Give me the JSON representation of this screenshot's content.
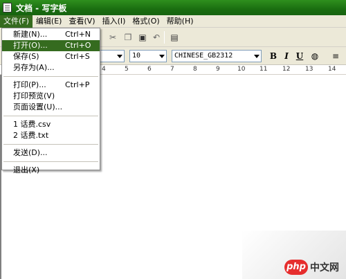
{
  "window": {
    "title": "文档 - 写字板"
  },
  "menubar": {
    "items": [
      {
        "label": "文件(F)"
      },
      {
        "label": "编辑(E)"
      },
      {
        "label": "查看(V)"
      },
      {
        "label": "插入(I)"
      },
      {
        "label": "格式(O)"
      },
      {
        "label": "帮助(H)"
      }
    ]
  },
  "toolbar": {
    "font_size": "10",
    "charset": "CHINESE_GB2312",
    "bold": "B",
    "italic": "I",
    "underline": "U"
  },
  "ruler": {
    "marks": [
      "4",
      "5",
      "6",
      "7",
      "8",
      "9",
      "10",
      "11",
      "12",
      "13",
      "14"
    ]
  },
  "file_menu": {
    "items": [
      {
        "label": "新建(N)...",
        "shortcut": "Ctrl+N"
      },
      {
        "label": "打开(O)...",
        "shortcut": "Ctrl+O"
      },
      {
        "label": "保存(S)",
        "shortcut": "Ctrl+S"
      },
      {
        "label": "另存为(A)...",
        "shortcut": ""
      },
      {
        "label": "打印(P)...",
        "shortcut": "Ctrl+P"
      },
      {
        "label": "打印预览(V)",
        "shortcut": ""
      },
      {
        "label": "页面设置(U)...",
        "shortcut": ""
      },
      {
        "label": "1 话费.csv",
        "shortcut": ""
      },
      {
        "label": "2 话费.txt",
        "shortcut": ""
      },
      {
        "label": "发送(D)...",
        "shortcut": ""
      },
      {
        "label": "退出(X)",
        "shortcut": ""
      }
    ]
  },
  "watermark": {
    "badge": "php",
    "text": "中文网"
  },
  "colors": {
    "titlebar": "#1a6e10",
    "highlight": "#356b1f",
    "menu_bg": "#ece9d8"
  }
}
